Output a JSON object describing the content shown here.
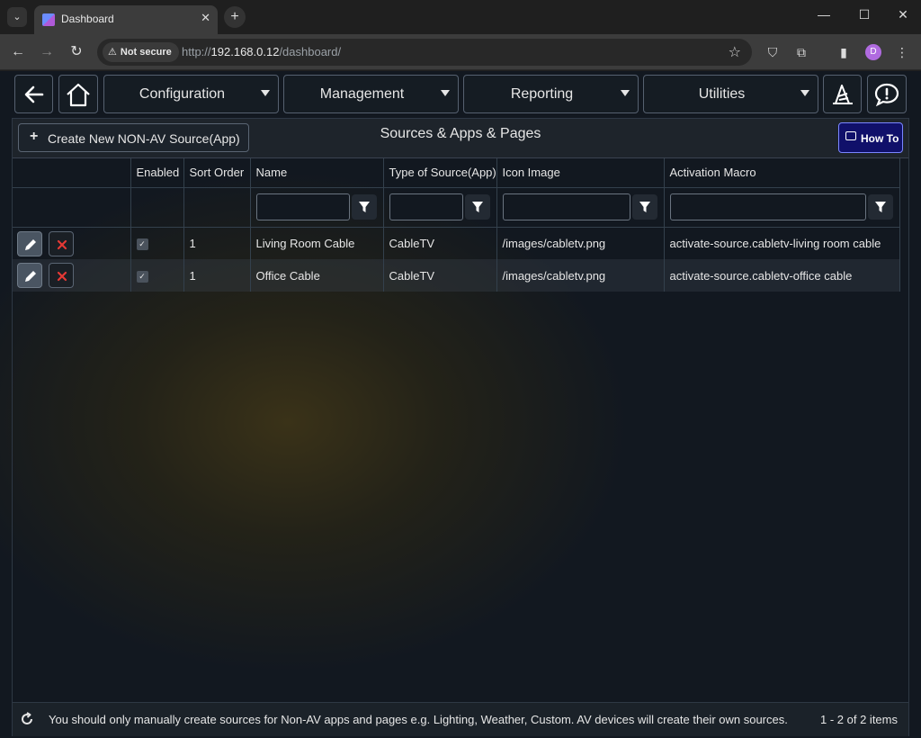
{
  "browser": {
    "tab_title": "Dashboard",
    "security_label": "Not secure",
    "url_prefix": "http://",
    "url_host": "192.168.0.12",
    "url_path": "/dashboard/",
    "profile_initial": "D"
  },
  "nav": {
    "menus": [
      "Configuration",
      "Management",
      "Reporting",
      "Utilities"
    ]
  },
  "toolbar": {
    "create_label": "Create New NON-AV Source(App)",
    "title": "Sources & Apps & Pages",
    "howto_label": "How To"
  },
  "table": {
    "columns": [
      "",
      "Enabled",
      "Sort Order",
      "Name",
      "Type of Source(App)",
      "Icon Image",
      "Activation Macro"
    ],
    "rows": [
      {
        "enabled": "✓",
        "sort": "1",
        "name": "Living Room Cable",
        "type": "CableTV",
        "icon": "/images/cabletv.png",
        "macro": "activate-source.cabletv-living room cable"
      },
      {
        "enabled": "✓",
        "sort": "1",
        "name": "Office Cable",
        "type": "CableTV",
        "icon": "/images/cabletv.png",
        "macro": "activate-source.cabletv-office cable"
      }
    ]
  },
  "footer": {
    "note": "You should only manually create sources for Non-AV apps and pages e.g. Lighting, Weather, Custom. AV devices will create their own sources.",
    "pager": "1 - 2 of 2 items"
  },
  "colors": {
    "accent_howto": "#10106a",
    "delete_x": "#e53935"
  }
}
